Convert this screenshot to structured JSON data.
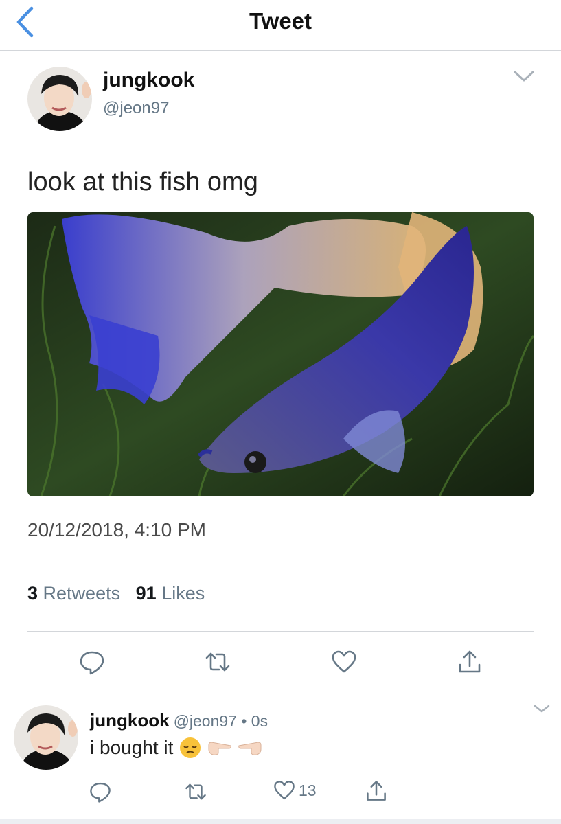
{
  "header": {
    "title": "Tweet"
  },
  "tweet": {
    "name": "jungkook",
    "handle": "@jeon97",
    "text": "look at this fish omg",
    "timestamp": "20/12/2018, 4:10 PM",
    "retweets_count": "3",
    "retweets_label": "Retweets",
    "likes_count": "91",
    "likes_label": "Likes"
  },
  "reply": {
    "name": "jungkook",
    "handle": "@jeon97 • 0s",
    "text": "i bought it",
    "likes_count": "13"
  },
  "colors": {
    "accent": "#4a90e2",
    "text": "#14171a",
    "muted": "#657786"
  }
}
